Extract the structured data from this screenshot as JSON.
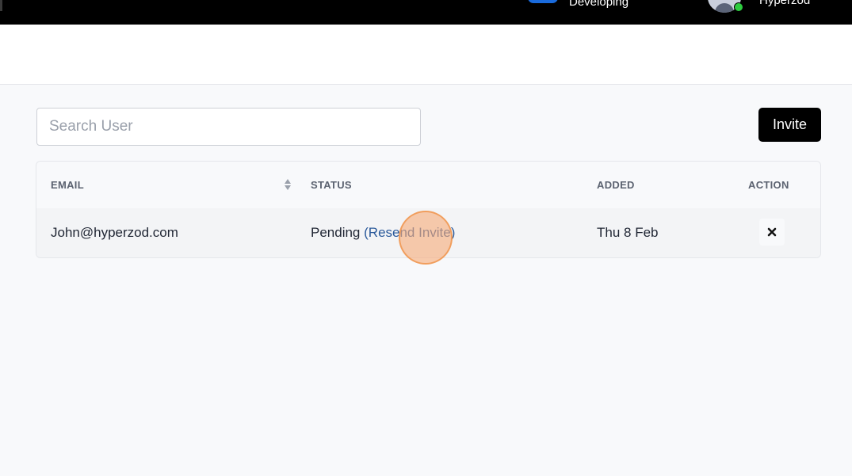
{
  "topbar": {
    "toggle_label": "Developing",
    "user_name": "Hyperzod"
  },
  "search": {
    "placeholder": "Search User",
    "value": ""
  },
  "invite_button": {
    "label": "Invite"
  },
  "table": {
    "headers": {
      "email": "EMAIL",
      "status": "STATUS",
      "added": "ADDED",
      "action": "ACTION"
    },
    "rows": [
      {
        "email": "John@hyperzod.com",
        "status": "Pending",
        "resend_label": "(Resend Invite)",
        "added": "Thu 8 Feb"
      }
    ]
  },
  "icons": {
    "sort": "sort-icon",
    "delete": "close-icon"
  },
  "colors": {
    "topbar": "#000000",
    "accent_link": "#2b5a9b",
    "toggle": "#1a6bdc",
    "online": "#2ecc40"
  }
}
